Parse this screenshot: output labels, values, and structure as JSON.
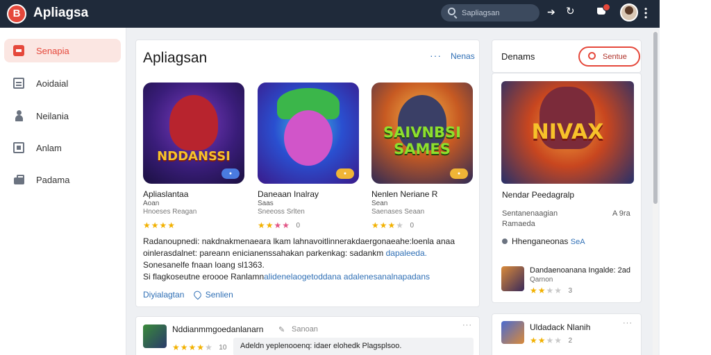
{
  "app": {
    "logo_glyph": "B",
    "title": "Apliagsa"
  },
  "search": {
    "placeholder": "Sapliagsan"
  },
  "topbar": {
    "icons": [
      "back-arrow-icon",
      "refresh-icon",
      "cart-icon",
      "avatar",
      "more-icon"
    ]
  },
  "sidebar": {
    "items": [
      {
        "label": "Senapia",
        "icon": "home-icon",
        "active": true
      },
      {
        "label": "Aoidaial",
        "icon": "calendar-icon"
      },
      {
        "label": "Neilania",
        "icon": "user-icon"
      },
      {
        "label": "Anlam",
        "icon": "document-icon"
      },
      {
        "label": "Padama",
        "icon": "package-icon"
      }
    ]
  },
  "main": {
    "title": "Apliagsan",
    "more_glyph": "···",
    "news_label": "Nenas",
    "games": [
      {
        "tile_text": "NDDANSSI",
        "name": "Apliaslantaa",
        "category": "Aoan",
        "developer": "Hnoeses Reagan",
        "rating": 4,
        "score": ""
      },
      {
        "tile_text": "",
        "name": "Daneaan Inalray",
        "category": "Saas",
        "developer": "Sneeoss Srlten",
        "rating": 3.5,
        "score": "0"
      },
      {
        "tile_text": "SAIVNBSI SAMES",
        "name": "Nenlen Neriane R",
        "category": "Sean",
        "developer": "Saenases Seaan",
        "rating": 3.5,
        "score": "0"
      }
    ],
    "description": {
      "line1": "Radanoupnedi: nakdnakmenaeara lkam lahnavoitlinnerakdaergonaeahe:loenla anaa",
      "line2_a": "oinlerasdalnet: pareann enicianenssahakan parkenkag: sadankm",
      "line2_b": "dapaleeda.",
      "line3": "Sonesanelfe fnaan loang sl1363.",
      "line4_a": "Si flagkoseutne eroooe Ranlamn",
      "line4_b": "alidenelaogetoddana adalenesanalnapadans"
    },
    "links": {
      "primary": "Diyialagtan",
      "secondary": "Senlien"
    }
  },
  "bottom_card": {
    "title": "Nddianmmgoedanlanarn",
    "sub_label": "Sanoan",
    "more_glyph": "···",
    "rating": 4,
    "score": "10",
    "field_text": "Adeldn yeplenooenq: idaer elohedk Plagsplsoo."
  },
  "right_panel": {
    "title": "Denams",
    "button_label": "Sentue",
    "featured": {
      "tile_text": "NIVAX",
      "name": "Nendar Peedagralp",
      "meta1": "Sentanenaagian",
      "meta2": "Ramaeda",
      "size_label": "A 9ra",
      "row_text": "Hhenganeonas",
      "row_highlight": "SeA"
    },
    "item": {
      "title": "Dandaenoanana Ingalde: 2ad",
      "sub": "Qarnon",
      "rating": 2,
      "score": "3"
    },
    "item2": {
      "title": "Uldadack Nlanih",
      "more_glyph": "···",
      "rating": 2,
      "score": "2"
    }
  },
  "colors": {
    "accent": "#e5483b",
    "topbar": "#1f2a3a",
    "link": "#2f6fb5",
    "star": "#f2b100"
  }
}
